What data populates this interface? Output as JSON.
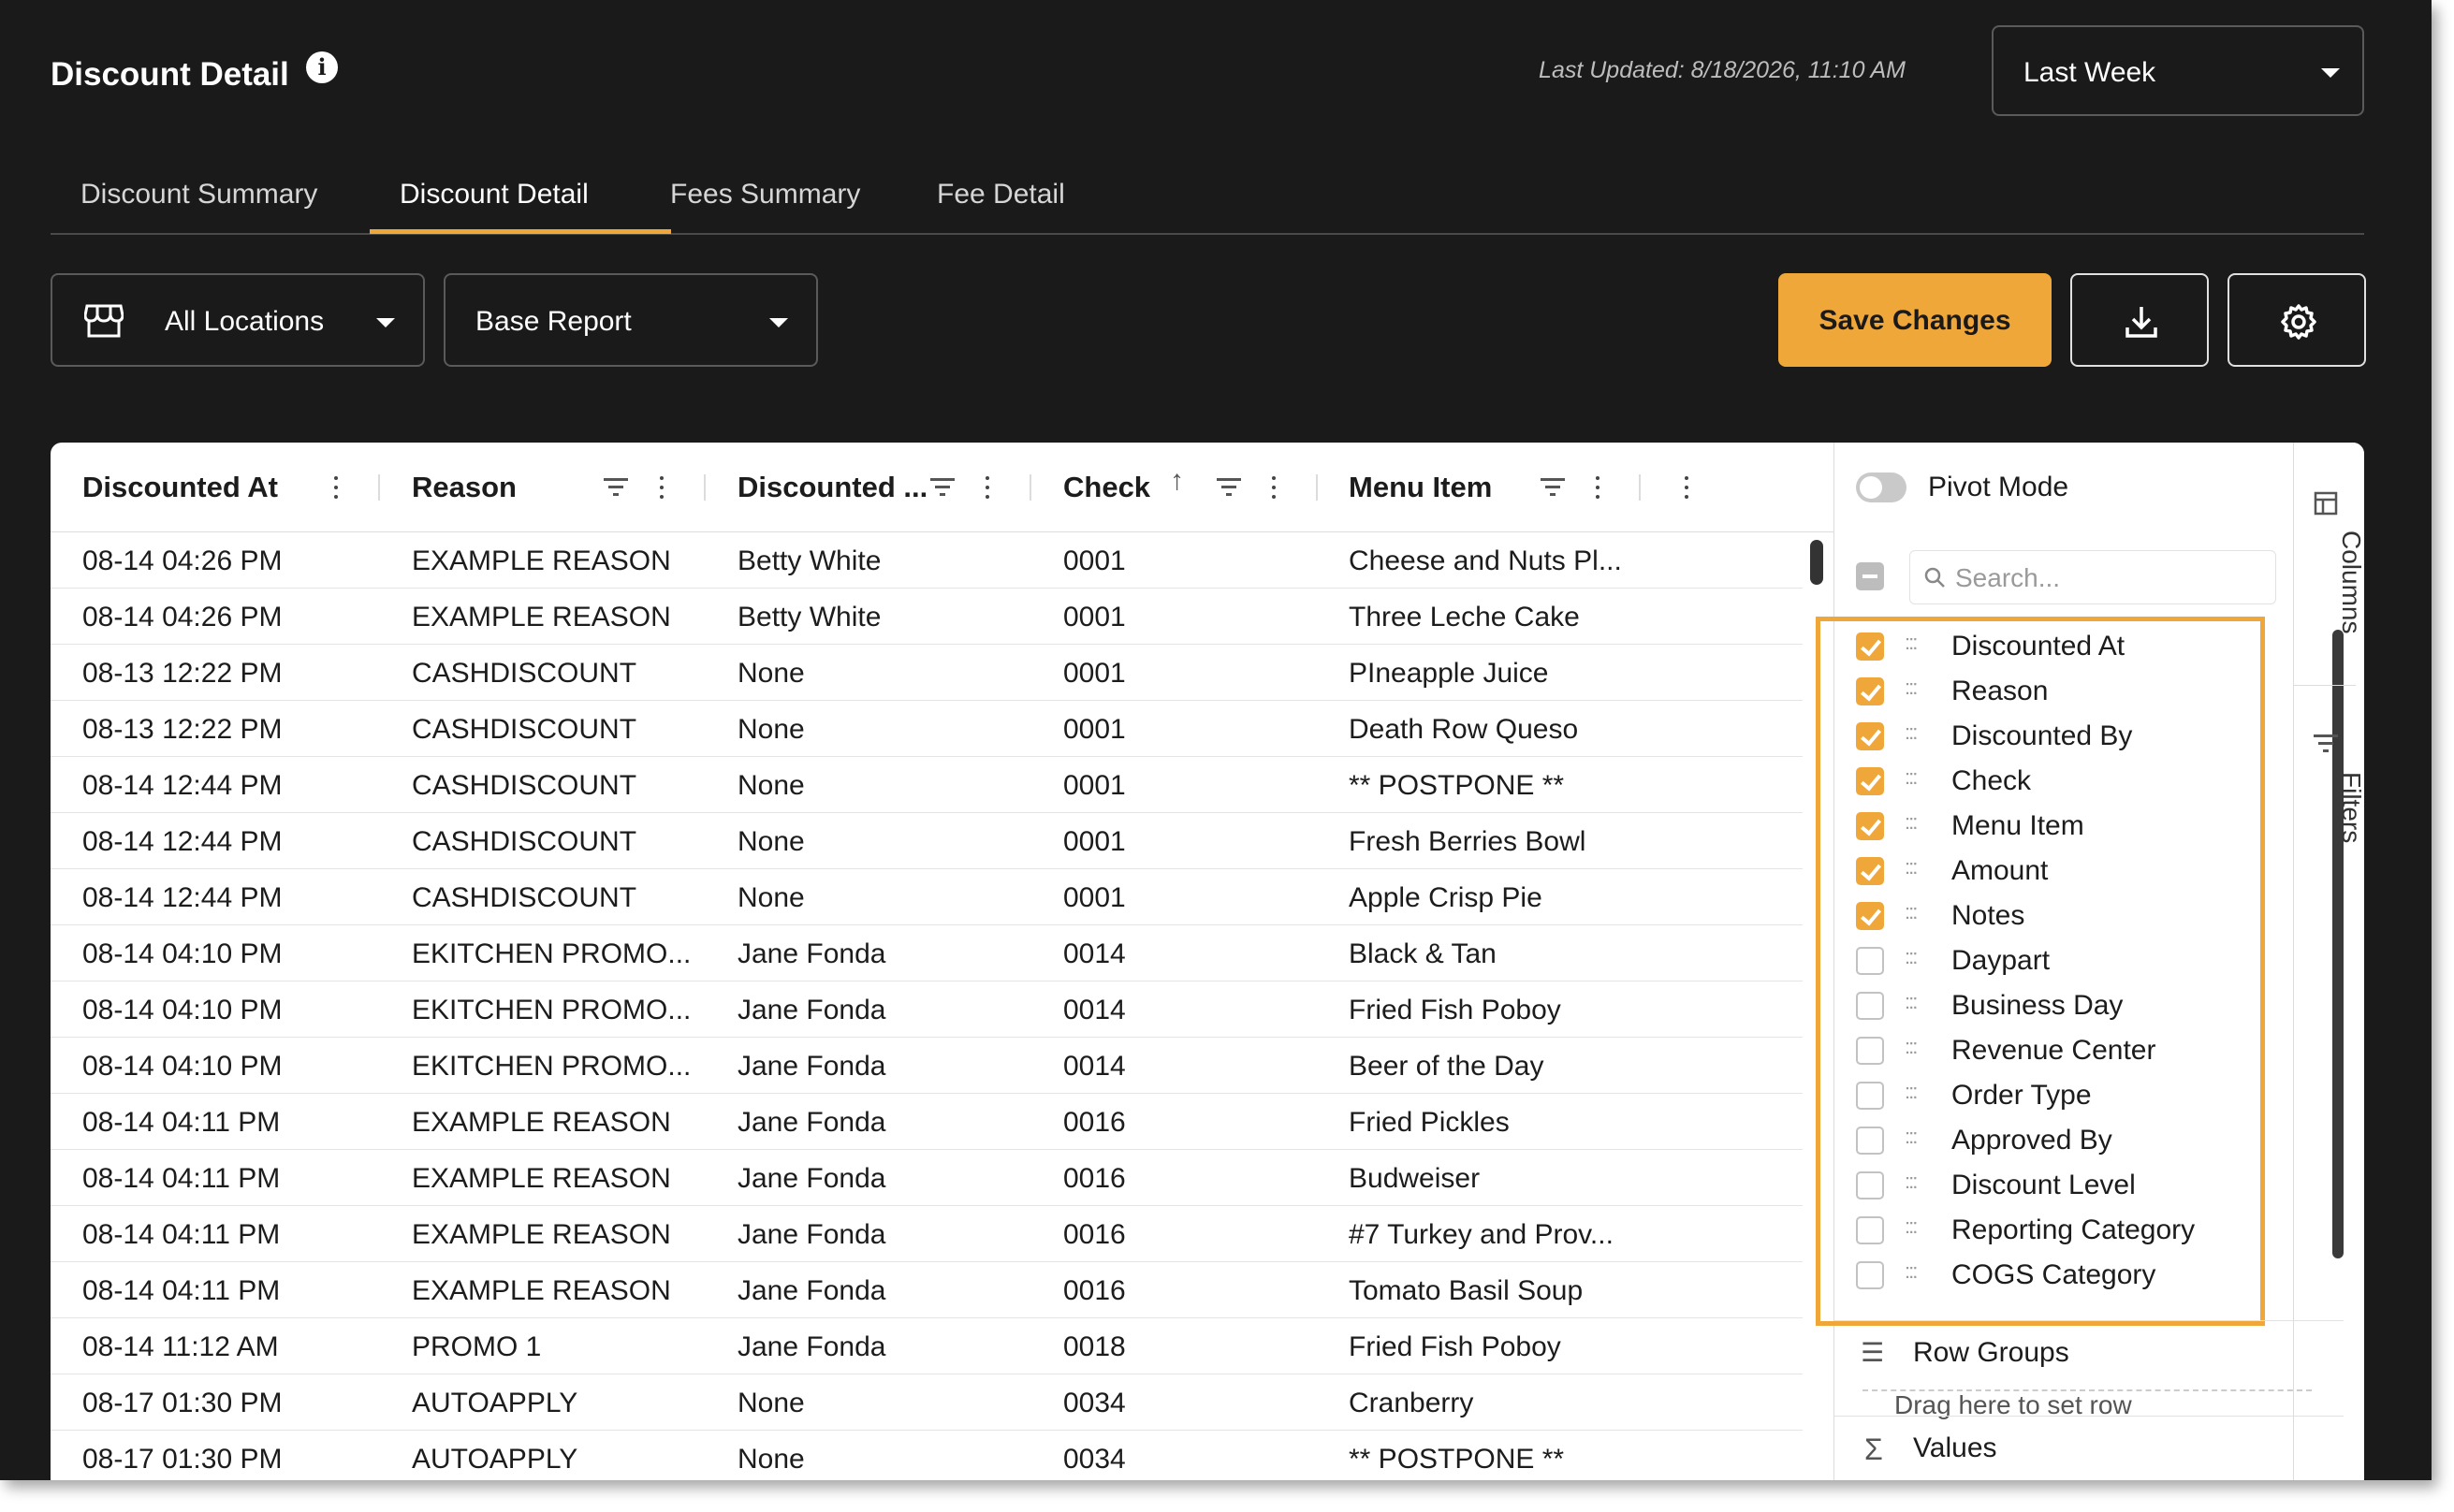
{
  "header": {
    "title": "Discount Detail",
    "last_updated": "Last Updated: 8/18/2026, 11:10 AM",
    "date_range": "Last Week"
  },
  "tabs": [
    {
      "label": "Discount Summary"
    },
    {
      "label": "Discount Detail"
    },
    {
      "label": "Fees Summary"
    },
    {
      "label": "Fee Detail"
    }
  ],
  "toolbar": {
    "location": "All Locations",
    "report": "Base Report",
    "save_label": "Save Changes"
  },
  "colors": {
    "accent": "#f0a73a",
    "background": "#1a1a1a"
  },
  "grid": {
    "columns": [
      "Discounted At",
      "Reason",
      "Discounted ...",
      "Check",
      "Menu Item"
    ],
    "rows": [
      [
        "08-14 04:26 PM",
        "EXAMPLE REASON",
        "Betty White",
        "0001",
        "Cheese and Nuts Pl..."
      ],
      [
        "08-14 04:26 PM",
        "EXAMPLE REASON",
        "Betty White",
        "0001",
        "Three Leche Cake"
      ],
      [
        "08-13 12:22 PM",
        "CASHDISCOUNT",
        "None",
        "0001",
        "PIneapple Juice"
      ],
      [
        "08-13 12:22 PM",
        "CASHDISCOUNT",
        "None",
        "0001",
        "Death Row Queso"
      ],
      [
        "08-14 12:44 PM",
        "CASHDISCOUNT",
        "None",
        "0001",
        "** POSTPONE **"
      ],
      [
        "08-14 12:44 PM",
        "CASHDISCOUNT",
        "None",
        "0001",
        "Fresh Berries Bowl"
      ],
      [
        "08-14 12:44 PM",
        "CASHDISCOUNT",
        "None",
        "0001",
        "Apple Crisp Pie"
      ],
      [
        "08-14 04:10 PM",
        "EKITCHEN PROMO...",
        "Jane Fonda",
        "0014",
        "Black & Tan"
      ],
      [
        "08-14 04:10 PM",
        "EKITCHEN PROMO...",
        "Jane Fonda",
        "0014",
        "Fried Fish Poboy"
      ],
      [
        "08-14 04:10 PM",
        "EKITCHEN PROMO...",
        "Jane Fonda",
        "0014",
        "Beer of the Day"
      ],
      [
        "08-14 04:11 PM",
        "EXAMPLE REASON",
        "Jane Fonda",
        "0016",
        "Fried Pickles"
      ],
      [
        "08-14 04:11 PM",
        "EXAMPLE REASON",
        "Jane Fonda",
        "0016",
        "Budweiser"
      ],
      [
        "08-14 04:11 PM",
        "EXAMPLE REASON",
        "Jane Fonda",
        "0016",
        "#7 Turkey and Prov..."
      ],
      [
        "08-14 04:11 PM",
        "EXAMPLE REASON",
        "Jane Fonda",
        "0016",
        "Tomato Basil Soup"
      ],
      [
        "08-14 11:12 AM",
        "PROMO 1",
        "Jane Fonda",
        "0018",
        "Fried Fish Poboy"
      ],
      [
        "08-17 01:30 PM",
        "AUTOAPPLY",
        "None",
        "0034",
        "Cranberry"
      ],
      [
        "08-17 01:30 PM",
        "AUTOAPPLY",
        "None",
        "0034",
        "** POSTPONE **"
      ]
    ]
  },
  "side_panel": {
    "pivot_mode_label": "Pivot Mode",
    "pivot_mode_on": false,
    "search_placeholder": "Search...",
    "columns": [
      {
        "label": "Discounted At",
        "checked": true
      },
      {
        "label": "Reason",
        "checked": true
      },
      {
        "label": "Discounted By",
        "checked": true
      },
      {
        "label": "Check",
        "checked": true
      },
      {
        "label": "Menu Item",
        "checked": true
      },
      {
        "label": "Amount",
        "checked": true
      },
      {
        "label": "Notes",
        "checked": true
      },
      {
        "label": "Daypart",
        "checked": false
      },
      {
        "label": "Business Day",
        "checked": false
      },
      {
        "label": "Revenue Center",
        "checked": false
      },
      {
        "label": "Order Type",
        "checked": false
      },
      {
        "label": "Approved By",
        "checked": false
      },
      {
        "label": "Discount Level",
        "checked": false
      },
      {
        "label": "Reporting Category",
        "checked": false
      },
      {
        "label": "COGS Category",
        "checked": false
      }
    ],
    "row_groups_label": "Row Groups",
    "row_groups_hint": "Drag here to set row",
    "values_label": "Values",
    "tab_columns": "Columns",
    "tab_filters": "Filters"
  }
}
